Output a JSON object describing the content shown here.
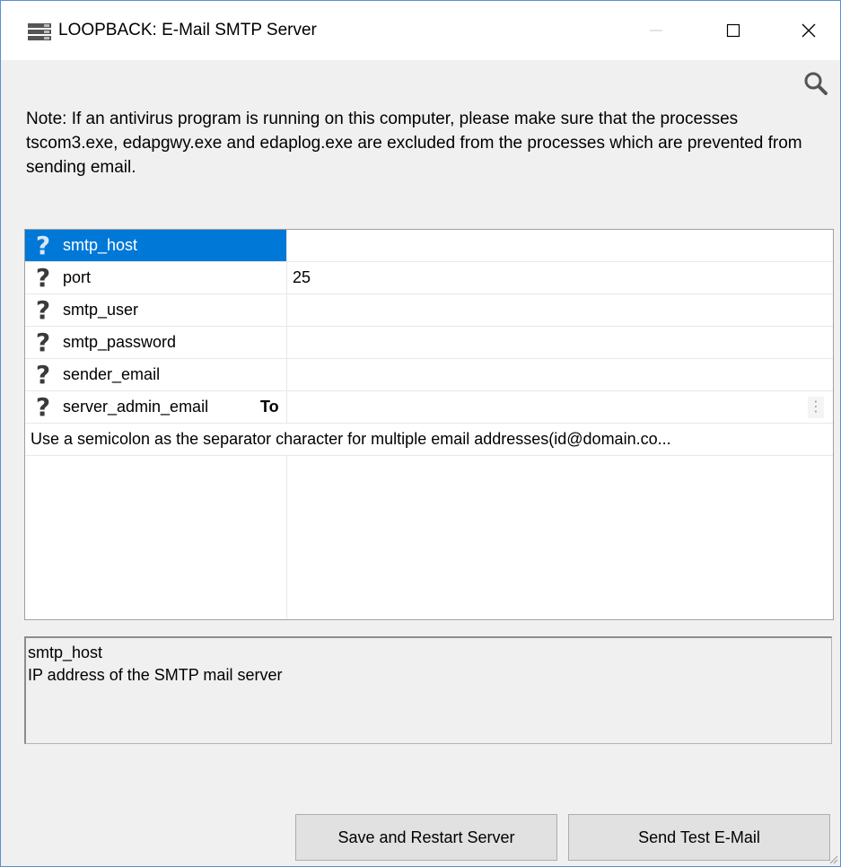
{
  "window": {
    "title": "LOOPBACK: E-Mail SMTP Server",
    "icon": "server-rack-icon",
    "controls": [
      "minimize-icon",
      "maximize-icon",
      "close-icon"
    ]
  },
  "toolbar": {
    "icon": "search-icon"
  },
  "note": "Note:  If an antivirus program is running on this computer, please make sure that the processes tscom3.exe, edapgwy.exe and edaplog.exe are excluded from the processes which are prevented from sending email.",
  "properties": [
    {
      "name": "smtp_host",
      "value": "",
      "selected": true,
      "icon": "help-question-icon"
    },
    {
      "name": "port",
      "value": "25",
      "selected": false,
      "icon": "help-question-icon"
    },
    {
      "name": "smtp_user",
      "value": "",
      "selected": false,
      "icon": "help-question-icon"
    },
    {
      "name": "smtp_password",
      "value": "",
      "selected": false,
      "icon": "help-question-icon"
    },
    {
      "name": "sender_email",
      "value": "",
      "selected": false,
      "icon": "help-question-icon"
    },
    {
      "name": "server_admin_email",
      "to_label": "To",
      "value": "",
      "selected": false,
      "icon": "help-question-icon",
      "more_icon": "vertical-ellipsis-icon"
    }
  ],
  "hint": "Use a semicolon as the separator character for multiple email addresses(id@domain.co...",
  "description": {
    "title": "smtp_host",
    "text": "IP address of the SMTP mail server"
  },
  "buttons": {
    "save": "Save and Restart Server",
    "test": "Send Test E-Mail"
  },
  "colors": {
    "selection": "#0078d7",
    "background": "#f0f0f0",
    "button": "#e1e1e1"
  }
}
